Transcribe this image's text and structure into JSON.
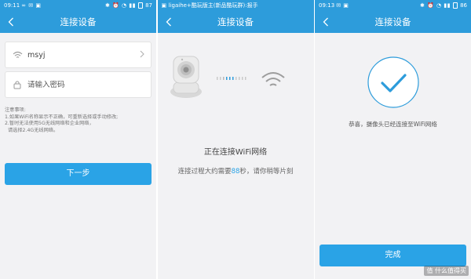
{
  "colors": {
    "primary": "#2d9cdb",
    "button": "#2aa3e6",
    "highlight": "#2aa3e6"
  },
  "screens": [
    {
      "status": {
        "time": "09:11",
        "battery": "87"
      },
      "title": "连接设备",
      "wifi_field": {
        "value": "msyj",
        "icon": "wifi-icon"
      },
      "password_field": {
        "placeholder": "请输入密码",
        "icon": "lock-icon"
      },
      "notes": [
        "注意事项:",
        "1.如果WiFi名称显示不正确，可重新选择或手动修改;",
        "2.暂时无法使用5G无线网络和企业网络，",
        "  请选择2.4G无线网络。"
      ],
      "next_label": "下一步"
    },
    {
      "status": {
        "title": "ligaihe+酷玩版主(新品酷玩群):报手"
      },
      "title": "连接设备",
      "connecting_text": "正在连接WiFi网络",
      "sub_prefix": "连接过程大约需要",
      "sub_seconds": "88",
      "sub_suffix": "秒，请你稍等片刻"
    },
    {
      "status": {
        "time": "09:13",
        "battery": "86"
      },
      "title": "连接设备",
      "success_text": "恭喜，摄像头已经连接至WiFi网络",
      "done_label": "完成",
      "watermark": "值 什么值得买"
    }
  ]
}
